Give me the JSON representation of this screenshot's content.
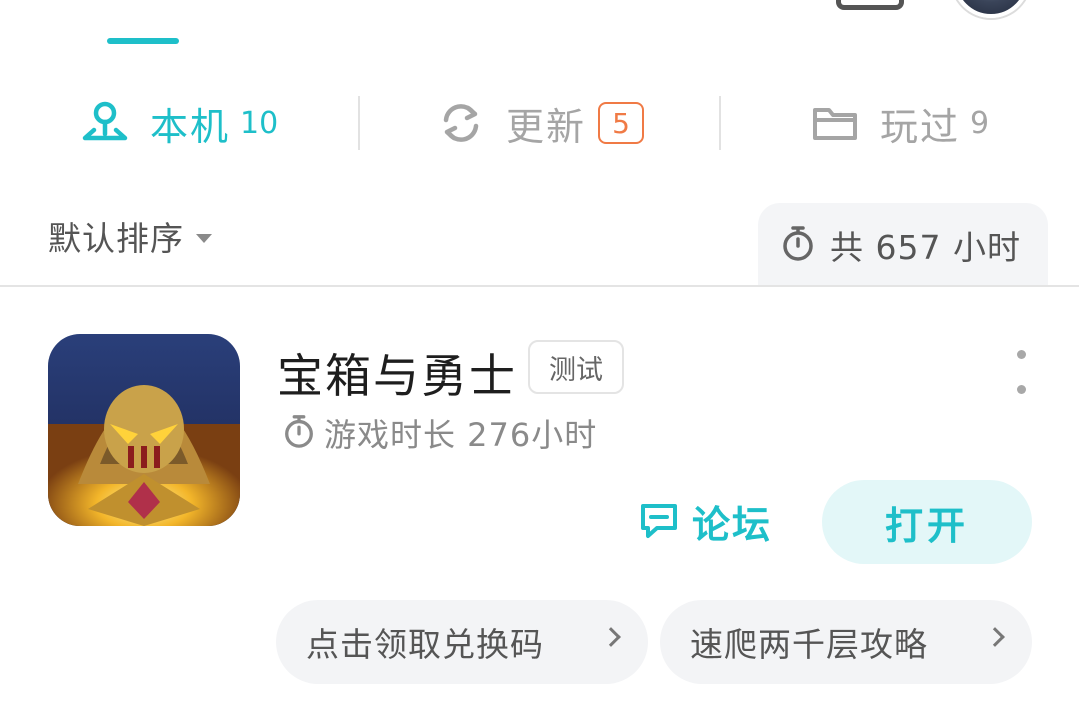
{
  "colors": {
    "accent": "#1ebfc9",
    "badge": "#f07a45",
    "muted": "#a5a5a5"
  },
  "filter_tabs": [
    {
      "label": "本机",
      "count": "10",
      "icon": "location-pin-icon"
    },
    {
      "label": "更新",
      "count": "5",
      "icon": "refresh-icon"
    },
    {
      "label": "玩过",
      "count": "9",
      "icon": "folder-icon"
    }
  ],
  "sort": {
    "label": "默认排序"
  },
  "total_time": {
    "text": "共 657 小时",
    "icon": "stopwatch-icon"
  },
  "game": {
    "title": "宝箱与勇士",
    "tag": "测试",
    "play_time": "游戏时长 276小时",
    "forum_label": "论坛",
    "open_label": "打开"
  },
  "chips": [
    {
      "label": "点击领取兑换码"
    },
    {
      "label": "速爬两千层攻略"
    }
  ]
}
